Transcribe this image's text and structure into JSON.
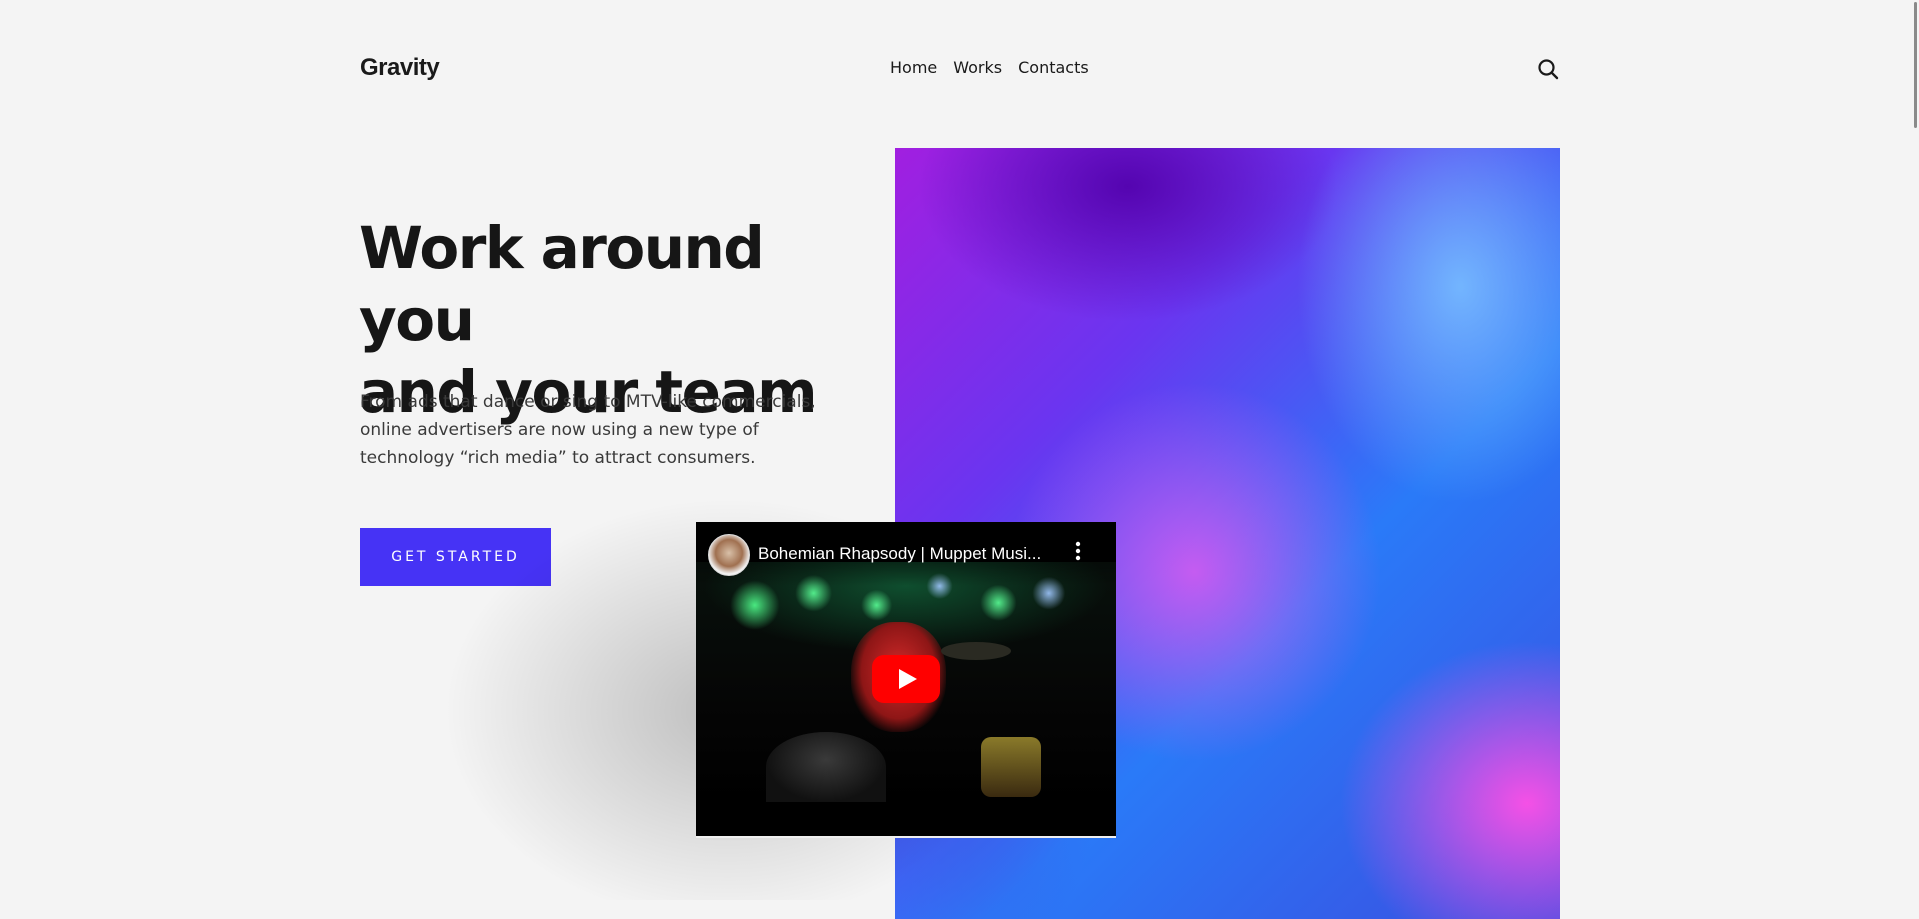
{
  "header": {
    "logo": "Gravity",
    "nav": [
      {
        "label": "Home"
      },
      {
        "label": "Works"
      },
      {
        "label": "Contacts"
      }
    ],
    "search_icon": "search-icon"
  },
  "hero": {
    "title_line1": "Work around you",
    "title_line2": "and your team",
    "description": "From ads that dance or sing to MTV-like commercials, online advertisers are now using a new type of technology “rich media” to attract consumers.",
    "cta_label": "GET STARTED"
  },
  "video": {
    "title": "Bohemian Rhapsody | Muppet Musi...",
    "menu_icon": "more-vert-icon",
    "play_icon": "youtube-play-icon"
  },
  "colors": {
    "accent": "#4633f5",
    "background": "#f4f4f4",
    "text": "#161616"
  }
}
